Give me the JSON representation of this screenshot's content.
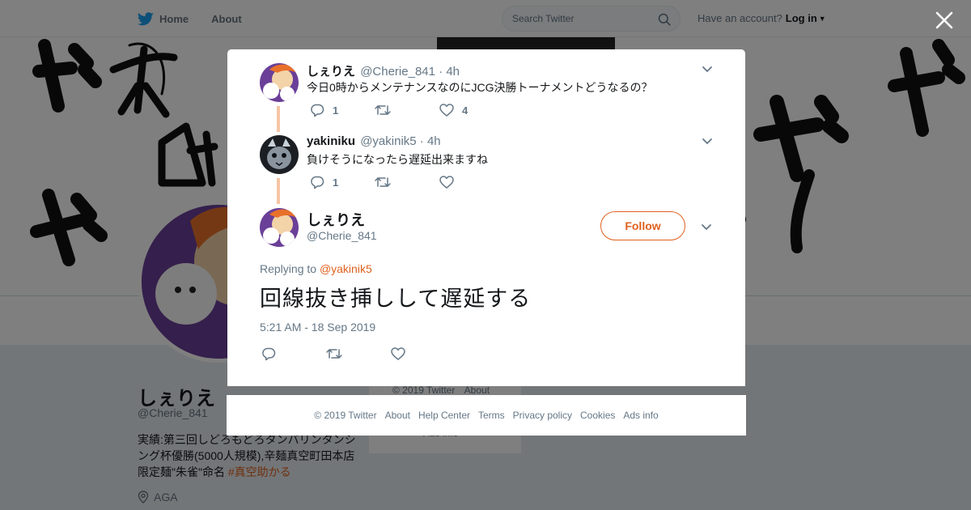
{
  "topnav": {
    "home_label": "Home",
    "about_label": "About",
    "search_placeholder": "Search Twitter",
    "account_prompt": "Have an account?",
    "login_label": "Log in"
  },
  "profile": {
    "name": "しぇりえ",
    "handle": "@Cherie_841",
    "bio_text": "実績:第三回しどろもどろタンバリンタンシング杯優勝(5000人規模),辛麺真空町田本店 限定麺\"朱雀\"命名 ",
    "bio_hashtag": "#真空助かる",
    "location": "AGA"
  },
  "sidebar": {
    "copyright": "© 2019 Twitter",
    "about": "About",
    "ads_info": "Ads info"
  },
  "thread": [
    {
      "fullname": "しぇりえ",
      "screen_name": "@Cherie_841",
      "time": "· 4h",
      "text": "今日0時からメンテナンスなのにJCG決勝トーナメントどうなるの？",
      "reply_count": "1",
      "retweet_count": "",
      "like_count": "4"
    },
    {
      "fullname": "yakiniku",
      "screen_name": "@yakinik5",
      "time": "· 4h",
      "text": "負けそうになったら遅延出来ますね",
      "reply_count": "1",
      "retweet_count": "",
      "like_count": ""
    }
  ],
  "main_tweet": {
    "fullname": "しぇりえ",
    "screen_name": "@Cherie_841",
    "follow_label": "Follow",
    "replying_prefix": "Replying to ",
    "replying_to": "@yakinik5",
    "text": "回線抜き挿しして遅延する",
    "timestamp": "5:21 AM - 18 Sep 2019"
  },
  "footer": {
    "links": [
      "© 2019 Twitter",
      "About",
      "Help Center",
      "Terms",
      "Privacy policy",
      "Cookies",
      "Ads info"
    ]
  },
  "colors": {
    "accent": "#e0611f",
    "twitter_blue": "#1da1f2",
    "thread_line": "#f6c5a5"
  }
}
